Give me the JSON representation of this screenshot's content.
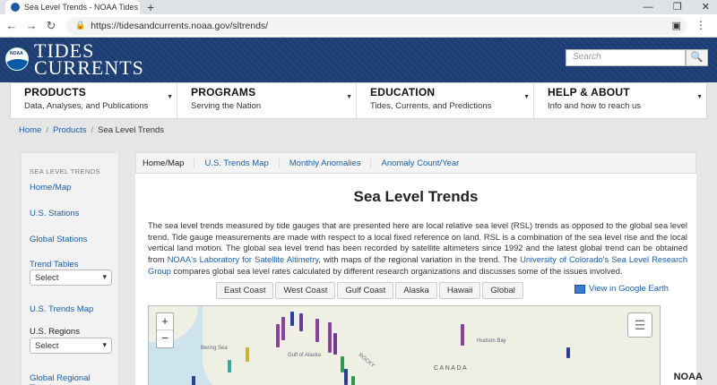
{
  "browser": {
    "tab_title": "Sea Level Trends - NOAA Tides &",
    "url": "https://tidesandcurrents.noaa.gov/sltrends/"
  },
  "header": {
    "logo_badge": "NOAA",
    "logo_line1": "TIDES",
    "logo_line2": "CURRENTS",
    "search_placeholder": "Search"
  },
  "nav": [
    {
      "title": "PRODUCTS",
      "sub": "Data, Analyses, and Publications"
    },
    {
      "title": "PROGRAMS",
      "sub": "Serving the Nation"
    },
    {
      "title": "EDUCATION",
      "sub": "Tides, Currents, and Predictions"
    },
    {
      "title": "HELP & ABOUT",
      "sub": "Info and how to reach us"
    }
  ],
  "breadcrumb": {
    "home": "Home",
    "products": "Products",
    "current": "Sea Level Trends"
  },
  "sidebar": {
    "heading": "SEA LEVEL TRENDS",
    "home_map": "Home/Map",
    "us_stations": "U.S. Stations",
    "global_stations": "Global Stations",
    "trend_tables": "Trend Tables",
    "select1": "Select",
    "us_trends_map": "U.S. Trends Map",
    "us_regions": "U.S. Regions",
    "select2": "Select",
    "global_regional": "Global Regional Trends"
  },
  "tabs": [
    "Home/Map",
    "U.S. Trends Map",
    "Monthly Anomalies",
    "Anomaly Count/Year"
  ],
  "page_title": "Sea Level Trends",
  "paragraph": {
    "p1": "The sea level trends measured by tide gauges that are presented here are local relative sea level (RSL) trends as opposed to the global sea level trend. Tide gauge measurements are made with respect to a local fixed reference on land. RSL is a combination of the sea level rise and the local vertical land motion. The global sea level trend has been recorded by satellite altimeters since 1992 and the latest global trend can be obtained from ",
    "link1": "NOAA's Laboratory for Satellite Altimetry",
    "p2": ", with maps of the regional variation in the trend. The ",
    "link2": "University of Colorado's Sea Level Research Group",
    "p3": " compares global sea level rates calculated by different research organizations and discusses some of the issues involved."
  },
  "regions": [
    "East Coast",
    "West Coast",
    "Gulf Coast",
    "Alaska",
    "Hawaii",
    "Global"
  ],
  "google_earth": "View in Google Earth",
  "map": {
    "zoom_in": "+",
    "zoom_out": "−",
    "labels": {
      "canada": "CANADA",
      "bering": "Bering Sea",
      "alaska": "Gulf of Alaska",
      "hudson": "Hudson Bay",
      "rocky": "ROCKY"
    }
  },
  "footer_mark": "NOAA"
}
